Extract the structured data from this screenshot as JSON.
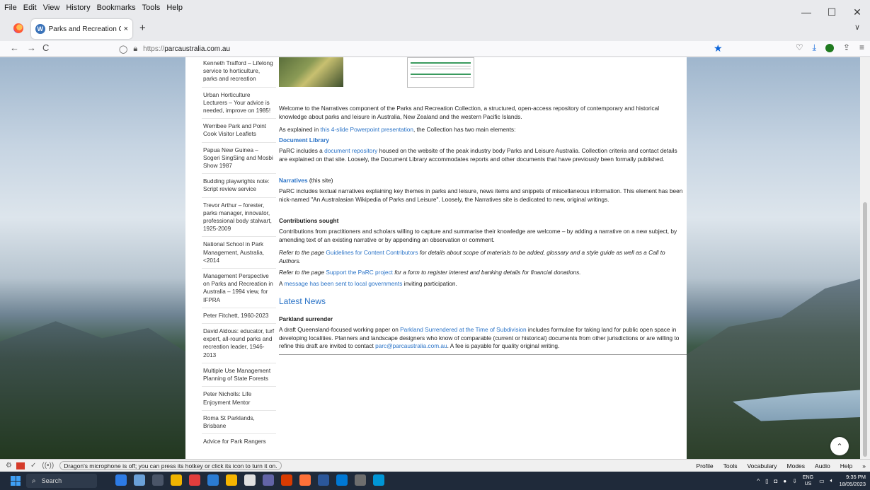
{
  "menubar": [
    "File",
    "Edit",
    "View",
    "History",
    "Bookmarks",
    "Tools",
    "Help"
  ],
  "window_controls": {
    "minimize": "—",
    "maximize": "☐",
    "close": "✕"
  },
  "tab": {
    "title": "Parks and Recreation Collection",
    "close": "×",
    "new_tab": "+",
    "list_tabs": "∨"
  },
  "nav": {
    "back": "←",
    "forward": "→",
    "reload": "C",
    "url_proto": "https://",
    "url_host": "parcaustralia.com.au"
  },
  "sidebar": {
    "items": [
      "Kenneth Trafford – Lifelong service to horticulture, parks and recreation",
      "Urban Horticulture Lecturers – Your advice is needed, improve on 1985!",
      "Werribee Park and Point Cook Visitor Leaflets",
      "Papua New Guinea – Sogeri SingSing and Mosbi Show 1987",
      "Budding playwrights note: Script review service",
      "Trevor Arthur – forester, parks manager, innovator, professional body stalwart, 1925-2009",
      "National School in Park Management, Australia, <2014",
      "Management Perspective on Parks and Recreation in Australia – 1994 view, for IFPRA",
      "Peter Fitchett, 1960-2023",
      "David Aldous: educator, turf expert, all-round parks and recreation leader, 1946-2013",
      "Multiple Use Management Planning of State Forests",
      "Peter Nicholls: Life Enjoyment Mentor",
      "Roma St Parklands, Brisbane",
      "Advice for Park Rangers"
    ]
  },
  "main": {
    "welcome": "Welcome to the Narratives component of the Parks and Recreation Collection, a structured, open-access repository of contemporary and historical knowledge about parks and leisure in Australia, New Zealand and the western Pacific Islands.",
    "explained_pre": "As explained in ",
    "explained_link": "this 4-slide Powerpoint presentation",
    "explained_post": ", the Collection has two main elements:",
    "doclib_heading": "Document Library",
    "doclib_pre": "PaRC includes a ",
    "doclib_link": "document repository",
    "doclib_post": " housed on the website of the peak industry body Parks and Leisure Australia. Collection criteria and contact details are explained on that site. Loosely, the Document Library accommodates reports and other documents that have previously been formally published.",
    "narr_heading": "Narratives",
    "narr_suffix": " (this site)",
    "narr_text": "PaRC includes textual narratives explaining key themes in parks and leisure, news items and snippets of miscellaneous information. This element has been nick-named \"An Australasian Wikipedia of Parks and Leisure\". Loosely, the Narratives site is dedicated to new, original writings.",
    "contrib_heading": "Contributions sought",
    "contrib_text": "Contributions from practitioners and scholars willing to capture and summarise their knowledge are welcome – by adding a narrative on a new subject, by amending text of an existing narrative or by appending an observation or comment.",
    "refer1_pre": "Refer to the page ",
    "refer1_link": "Guidelines for Content Contributors",
    "refer1_post": " for details about scope of materials to be added, glossary and a style guide as well as a Call to Authors.",
    "refer2_pre": "Refer to the page ",
    "refer2_link": "Support the PaRC project",
    "refer2_post": " for a form to register interest and banking details for financial donations.",
    "msg_pre": "A ",
    "msg_link": "message has been sent to local governments",
    "msg_post": " inviting participation.",
    "latest_news": "Latest News",
    "news_heading": "Parkland surrender",
    "news_pre": "A draft Queensland-focused working paper on ",
    "news_link": "Parkland Surrendered at the Time of Subdivision",
    "news_mid": " includes formulae for taking land for public open space in developing localities. Planners and landscape designers who know of comparable (current or historical) documents from other jurisdictions or are willing to refine this draft are invited to contact ",
    "news_email": "parc@parcaustralia.com.au",
    "news_post": ". A fee is payable for quality original writing."
  },
  "scroll_top": "⌃",
  "dragon": {
    "message": "Dragon's microphone is off; you can press its hotkey or click its icon to turn it on.",
    "menu": [
      "Profile",
      "Tools",
      "Vocabulary",
      "Modes",
      "Audio",
      "Help"
    ]
  },
  "taskbar": {
    "search": "Search",
    "lang_top": "ENG",
    "lang_bottom": "US",
    "time": "9:35 PM",
    "date": "18/05/2023",
    "app_colors": [
      "#2d7be5",
      "#6aa0d8",
      "#4a5568",
      "#f0b400",
      "#e23d3d",
      "#2b7cd3",
      "#f7b500",
      "#e0e0e0",
      "#6264a7",
      "#d83b01",
      "#ff7139",
      "#2b579a",
      "#0078d4",
      "#6e6e6e",
      "#0096d6"
    ]
  },
  "colors": {
    "link": "#2a73c7",
    "accent": "#0a63d9"
  }
}
